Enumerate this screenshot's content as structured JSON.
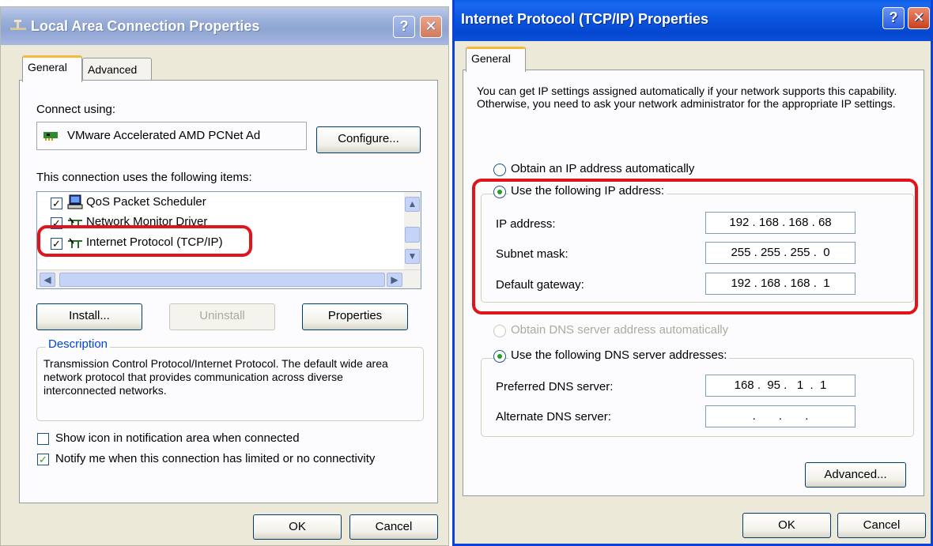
{
  "lan_window": {
    "title": "Local Area Connection Properties",
    "help": "?",
    "close": "✕",
    "tabs": [
      "General",
      "Advanced"
    ],
    "connect_using_label": "Connect using:",
    "adapter_name": "VMware Accelerated AMD PCNet Ad",
    "configure_label": "Configure...",
    "items_label": "This connection uses the following items:",
    "items": [
      {
        "label": "QoS Packet Scheduler",
        "checked": true
      },
      {
        "label": "Network Monitor Driver",
        "checked": true
      },
      {
        "label": "Internet Protocol (TCP/IP)",
        "checked": true
      }
    ],
    "install_label": "Install...",
    "uninstall_label": "Uninstall",
    "properties_label": "Properties",
    "description_legend": "Description",
    "description_text": "Transmission Control Protocol/Internet Protocol. The default wide area network protocol that provides communication across diverse interconnected networks.",
    "show_icon_label": "Show icon in notification area when connected",
    "show_icon_checked": false,
    "notify_label": "Notify me when this connection has limited or no connectivity",
    "notify_checked": true,
    "ok_label": "OK",
    "cancel_label": "Cancel"
  },
  "tcp_window": {
    "title": "Internet Protocol (TCP/IP) Properties",
    "help": "?",
    "close": "✕",
    "tab": "General",
    "intro_text": "You can get IP settings assigned automatically if your network supports this capability. Otherwise, you need to ask your network administrator for the appropriate IP settings.",
    "obtain_ip_label": "Obtain an IP address automatically",
    "use_ip_label": "Use the following IP address:",
    "ip_label": "IP address:",
    "ip_value": "192 . 168 . 168 . 68",
    "subnet_label": "Subnet mask:",
    "subnet_value": "255 . 255 . 255 .  0",
    "gateway_label": "Default gateway:",
    "gateway_value": "192 . 168 . 168 .  1",
    "obtain_dns_label": "Obtain DNS server address automatically",
    "use_dns_label": "Use the following DNS server addresses:",
    "preferred_dns_label": "Preferred DNS server:",
    "preferred_dns_value": "168 .  95 .   1  .  1",
    "alternate_dns_label": "Alternate DNS server:",
    "alternate_dns_value": ".       .       .",
    "advanced_label": "Advanced...",
    "ok_label": "OK",
    "cancel_label": "Cancel"
  },
  "colors": {
    "highlight": "#e0141b",
    "xp_title_blue": "#0a55df",
    "dialog_bg": "#ece9d8"
  }
}
